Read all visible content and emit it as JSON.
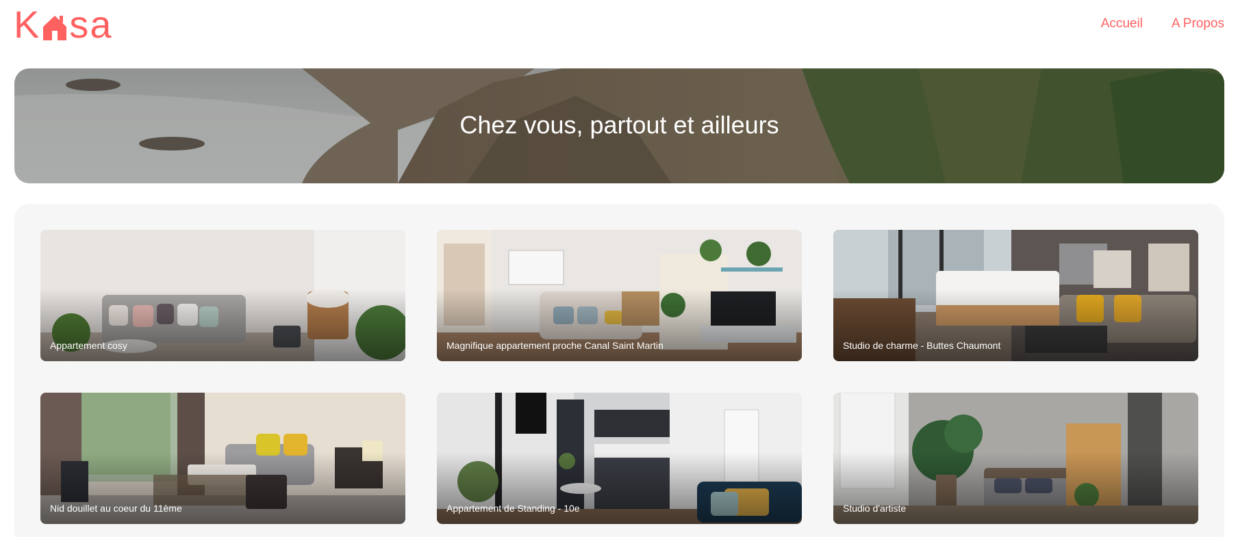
{
  "header": {
    "logo": {
      "text_left": "K",
      "text_right": "sa",
      "color": "#ff6060"
    },
    "nav": [
      {
        "label": "Accueil"
      },
      {
        "label": "A Propos"
      }
    ]
  },
  "banner": {
    "title": "Chez vous, partout et ailleurs"
  },
  "gallery": {
    "cards": [
      {
        "title": "Appartement cosy"
      },
      {
        "title": "Magnifique appartement proche Canal Saint Martin"
      },
      {
        "title": "Studio de charme - Buttes Chaumont"
      },
      {
        "title": "Nid douillet au coeur du 11ème"
      },
      {
        "title": "Appartement de Standing - 10e"
      },
      {
        "title": "Studio d'artiste"
      }
    ]
  },
  "colors": {
    "accent": "#ff6060",
    "gallery_bg": "#f6f6f6"
  }
}
